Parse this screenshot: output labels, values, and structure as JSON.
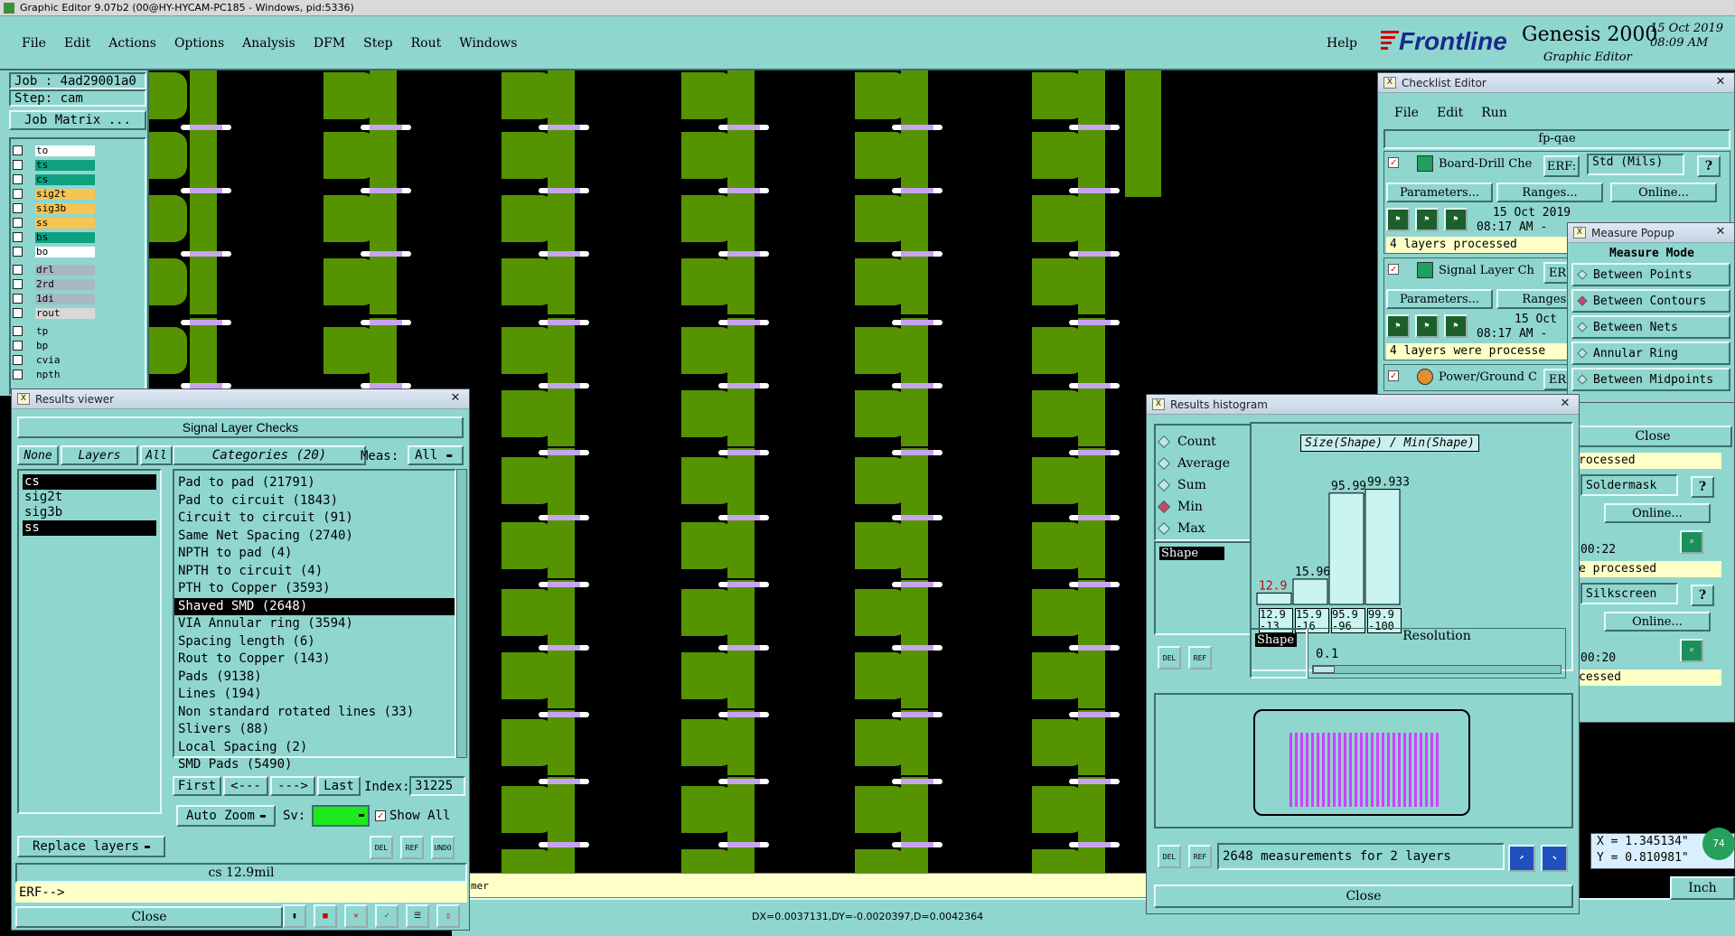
{
  "window_title": "Graphic Editor 9.07b2 (00@HY-HYCAM-PC185 - Windows, pid:5336)",
  "menu": [
    "File",
    "Edit",
    "Actions",
    "Options",
    "Analysis",
    "DFM",
    "Step",
    "Rout",
    "Windows"
  ],
  "help_label": "Help",
  "brand": {
    "name": "Frontline",
    "product": "Genesis 2000",
    "subtitle": "Graphic Editor",
    "date": "15 Oct 2019",
    "time": "08:09 AM"
  },
  "job": {
    "job_label": "Job : 4ad29001a0",
    "step_label": "Step: cam",
    "matrix_btn": "Job Matrix ..."
  },
  "layers": [
    {
      "name": "to",
      "color": "#ffffff"
    },
    {
      "name": "ts",
      "color": "#0fa080"
    },
    {
      "name": "cs",
      "color": "#0fa080"
    },
    {
      "name": "sig2t",
      "color": "#f5c452"
    },
    {
      "name": "sig3b",
      "color": "#f5c452"
    },
    {
      "name": "ss",
      "color": "#f5c452"
    },
    {
      "name": "bs",
      "color": "#0fa080"
    },
    {
      "name": "bo",
      "color": "#ffffff"
    },
    {
      "name": "drl",
      "color": "#a8b8c0"
    },
    {
      "name": "2rd",
      "color": "#a8b8c0"
    },
    {
      "name": "1di",
      "color": "#a8b8c0"
    },
    {
      "name": "rout",
      "color": "#d8d8d8"
    },
    {
      "name": "tp",
      "color": "#8fd6cf"
    },
    {
      "name": "bp",
      "color": "#8fd6cf"
    },
    {
      "name": "cvia",
      "color": "#8fd6cf"
    },
    {
      "name": "npth",
      "color": "#8fd6cf"
    }
  ],
  "results_viewer": {
    "title": "Results viewer",
    "header": "Signal Layer Checks",
    "none_btn": "None",
    "layers_btn": "Layers",
    "all_btn": "All",
    "categories_btn": "Categories (20)",
    "meas_label": "Meas:",
    "meas_value": "All",
    "layer_list": [
      "cs",
      "sig2t",
      "sig3b",
      "ss"
    ],
    "categories": [
      "Pad to pad (21791)",
      "Pad to circuit (1843)",
      "Circuit to circuit (91)",
      "Same Net Spacing (2740)",
      "NPTH to pad (4)",
      "NPTH to circuit (4)",
      "PTH to Copper (3593)",
      "Shaved SMD (2648)",
      "VIA Annular ring (3594)",
      "Spacing length (6)",
      "Rout to Copper (143)",
      "Pads (9138)",
      "Lines (194)",
      "Non standard rotated lines (33)",
      "Slivers (88)",
      "Local Spacing (2)",
      "SMD Pads (5490)"
    ],
    "first_btn": "First",
    "prev_btn": "<---",
    "next_btn": "--->",
    "last_btn": "Last",
    "index_label": "Index:",
    "index_value": "31225",
    "zoom_btn": "Auto Zoom",
    "sv_label": "Sv:",
    "show_all": "Show All",
    "replace_btn": "Replace layers",
    "status": "cs 12.9mil",
    "erf": "ERF-->",
    "close": "Close",
    "del": "DEL",
    "ref": "REF",
    "und": "UNDO"
  },
  "checklist": {
    "title": "Checklist Editor",
    "menu": [
      "File",
      "Edit",
      "Run"
    ],
    "name": "fp-qae",
    "rows": [
      {
        "name": "Board-Drill Che",
        "erf": "ERF:",
        "erf_val": "Std (Mils)",
        "date": "15 Oct 2019",
        "time": "08:17 AM -",
        "status": "4 layers processed"
      },
      {
        "name": "Signal Layer Ch",
        "erf": "ERF",
        "erf_val": "",
        "date": "15 Oct",
        "time": "08:17 AM -",
        "status": "4 layers were processe"
      },
      {
        "name": "Power/Ground C",
        "erf": "ERF",
        "erf_val": "",
        "date": "",
        "time": "",
        "status": ""
      }
    ],
    "params_btn": "Parameters...",
    "ranges_btn": "Ranges...",
    "online_btn": "Online...",
    "partial": [
      {
        "text": "rocessed"
      },
      {
        "erf_val": "Soldermask",
        "time": "00:22",
        "status": "e processed"
      },
      {
        "erf_val": "Silkscreen",
        "time": "00:20",
        "status": "cessed"
      }
    ],
    "close": "Close"
  },
  "measure": {
    "title": "Measure Popup",
    "mode_label": "Measure Mode",
    "options": [
      "Between Points",
      "Between Contours",
      "Between Nets",
      "Annular Ring",
      "Between Midpoints"
    ],
    "selected": 1
  },
  "histogram": {
    "title": "Results histogram",
    "stats": [
      "Count",
      "Average",
      "Sum",
      "Min",
      "Max"
    ],
    "selected_stat": 3,
    "chart_title": "Size(Shape) / Min(Shape)",
    "shape_label": "Shape",
    "bars": [
      {
        "label": "12.9",
        "range": "12.9-13",
        "height_frac": 0.09,
        "color": "#d00000"
      },
      {
        "label": "15.96",
        "range": "15.9-16",
        "height_frac": 0.2,
        "color": "#000"
      },
      {
        "label": "95.99",
        "range": "95.9-96",
        "height_frac": 0.88,
        "color": "#000"
      },
      {
        "label": "99.933",
        "range": "99.9-100",
        "height_frac": 0.91,
        "color": "#000"
      }
    ],
    "resolution_label": "Resolution",
    "resolution_value": "0.1",
    "summary": "2648 measurements for 2 layers",
    "close": "Close"
  },
  "coords": {
    "x": "X = 1.345134\"",
    "y": "Y = 0.810981\"",
    "units": "Inch",
    "badge": "74"
  },
  "bottom_bar": "DX=0.0037131,DY=-0.0020397,D=0.0042364",
  "bottom_hint": "mer"
}
